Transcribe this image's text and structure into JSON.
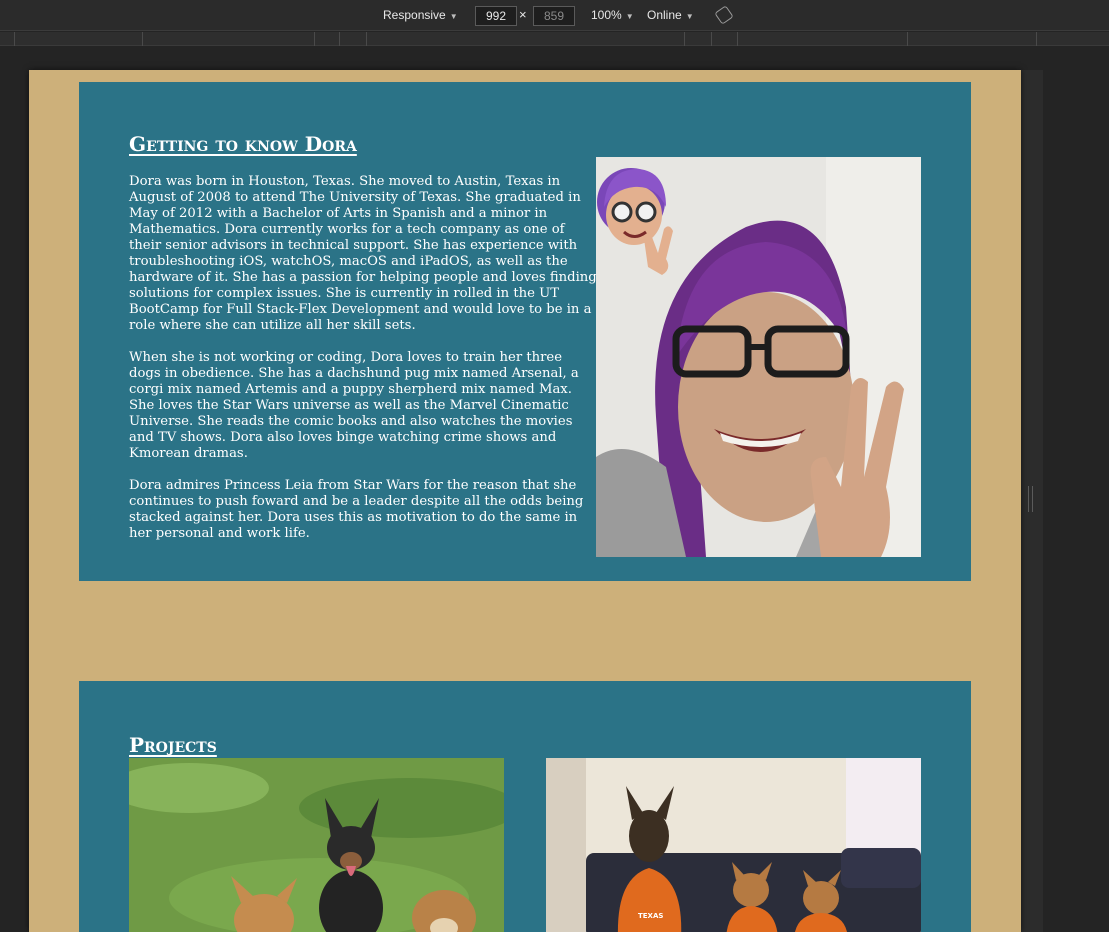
{
  "devtools": {
    "device_mode": "Responsive",
    "width_value": "992",
    "height_placeholder": "859",
    "zoom": "100%",
    "network": "Online",
    "times_symbol": "×",
    "rotate_icon": "rotate-icon"
  },
  "about": {
    "title": "Getting to know Dora",
    "paragraphs": [
      "Dora was born in Houston, Texas. She moved to Austin, Texas in August of 2008 to attend The University of Texas. She graduated in May of 2012 with a Bachelor of Arts in Spanish and a minor in Mathematics. Dora currently works for a tech company as one of their senior advisors in technical support. She has experience with troubleshooting iOS, watchOS, macOS and iPadOS, as well as the hardware of it. She has a passion for helping people and loves finding solutions for complex issues. She is currently in rolled in the UT BootCamp for Full Stack-Flex Development and would love to be in a role where she can utilize all her skill sets.",
      "When she is not working or coding, Dora loves to train her three dogs in obedience. She has a dachshund pug mix named Arsenal, a corgi mix named Artemis and a puppy sherpherd mix named Max. She loves the Star Wars universe as well as the Marvel Cinematic Universe. She reads the comic books and also watches the movies and TV shows. Dora also loves binge watching crime shows and Kmorean dramas.",
      "Dora admires Princess Leia from Star Wars for the reason that she continues to push foward and be a leader despite all the odds being stacked against her. Dora uses this as motivation to do the same in her personal and work life."
    ]
  },
  "projects": {
    "title": "Projects",
    "jersey_text": "TEXAS"
  },
  "colors": {
    "page_background": "#cdb07a",
    "card_background": "#2b7387",
    "devtools_background": "#242424"
  }
}
